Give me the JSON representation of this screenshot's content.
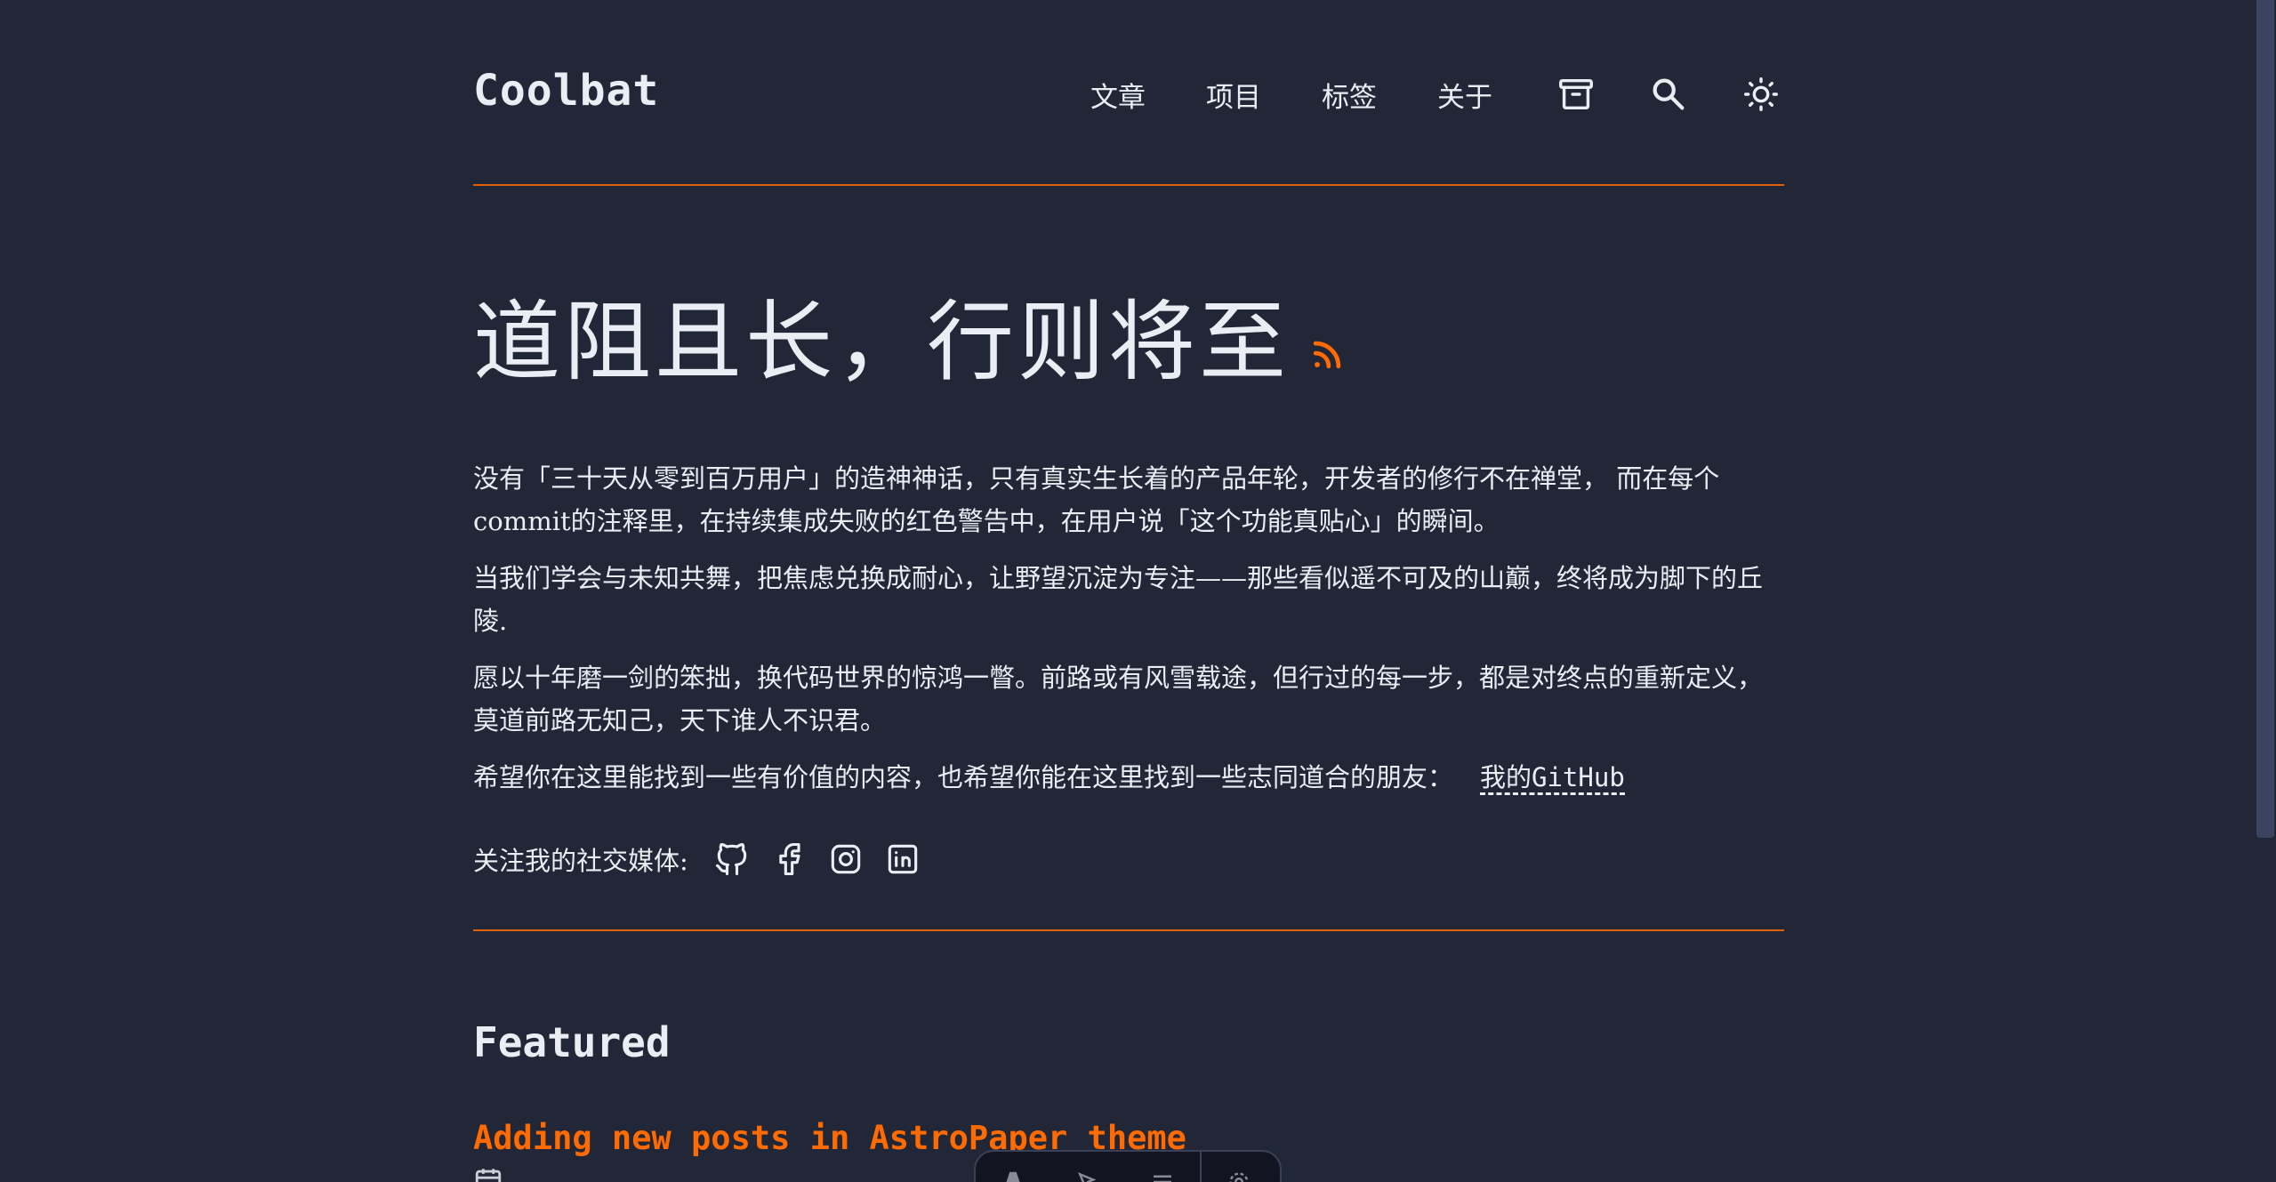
{
  "site": {
    "logo": "Coolbat"
  },
  "nav": {
    "links": [
      "文章",
      "项目",
      "标签",
      "关于"
    ],
    "icons": [
      "archive-icon",
      "search-icon",
      "sun-icon"
    ]
  },
  "hero": {
    "title": "道阻且长，行则将至",
    "paragraphs": [
      "没有「三十天从零到百万用户」的造神神话，只有真实生长着的产品年轮，开发者的修行不在禅堂，  而在每个commit的注释里，在持续集成失败的红色警告中，在用户说「这个功能真贴心」的瞬间。",
      "当我们学会与未知共舞，把焦虑兑换成耐心，让野望沉淀为专注——那些看似遥不可及的山巅，终将成为脚下的丘陵.",
      "愿以十年磨一剑的笨拙，换代码世界的惊鸿一瞥。前路或有风雪载途，但行过的每一步，都是对终点的重新定义，  莫道前路无知己，天下谁人不识君。",
      "希望你在这里能找到一些有价值的内容，也希望你能在这里找到一些志同道合的朋友："
    ],
    "github_link": "我的GitHub",
    "social_label": "关注我的社交媒体:",
    "social_icons": [
      "github-icon",
      "facebook-icon",
      "instagram-icon",
      "linkedin-icon"
    ]
  },
  "featured": {
    "heading": "Featured",
    "post_title": "Adding new posts in AstroPaper theme"
  },
  "toolbar": {
    "icons": [
      "astro-icon",
      "inspect-icon",
      "menu-icon",
      "settings-icon"
    ]
  },
  "colors": {
    "background": "#212737",
    "text": "#eaedf3",
    "accent": "#ff6b01"
  }
}
